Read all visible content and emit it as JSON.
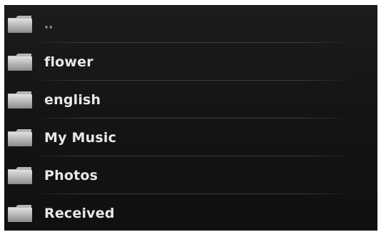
{
  "file_browser": {
    "entries": [
      {
        "name": "..",
        "icon": "folder-icon"
      },
      {
        "name": "flower",
        "icon": "folder-icon"
      },
      {
        "name": "english",
        "icon": "folder-icon"
      },
      {
        "name": "My Music",
        "icon": "folder-icon"
      },
      {
        "name": "Photos",
        "icon": "folder-icon"
      },
      {
        "name": "Received",
        "icon": "folder-icon"
      }
    ]
  },
  "colors": {
    "background": "#141414",
    "text": "#e8e8e8",
    "divider": "#3d3d3d",
    "folder_light": "#d8d8d8",
    "folder_dark": "#8a8a8a"
  }
}
